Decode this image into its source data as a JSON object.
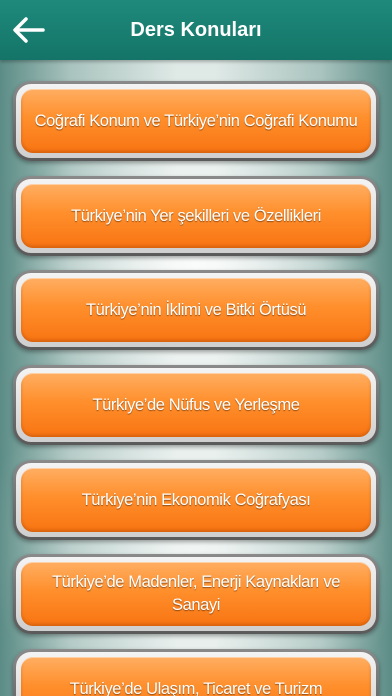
{
  "header": {
    "title": "Ders Konuları",
    "back_icon": "arrow-left-icon"
  },
  "topics": [
    {
      "label": "Coğrafi Konum ve Türkiye’nin Coğrafi Konumu"
    },
    {
      "label": "Türkiye’nin Yer şekilleri ve Özellikleri"
    },
    {
      "label": "Türkiye’nin İklimi ve Bitki Örtüsü"
    },
    {
      "label": "Türkiye’de Nüfus ve Yerleşme"
    },
    {
      "label": "Türkiye’nin Ekonomik Coğrafyası"
    },
    {
      "label": "Türkiye’de Madenler, Enerji Kaynakları ve Sanayi"
    },
    {
      "label": "Türkiye’de Ulaşım, Ticaret ve Turizm"
    }
  ],
  "colors": {
    "header": "#137467",
    "button": "#ff8f2c",
    "button_text": "#ffffff"
  }
}
